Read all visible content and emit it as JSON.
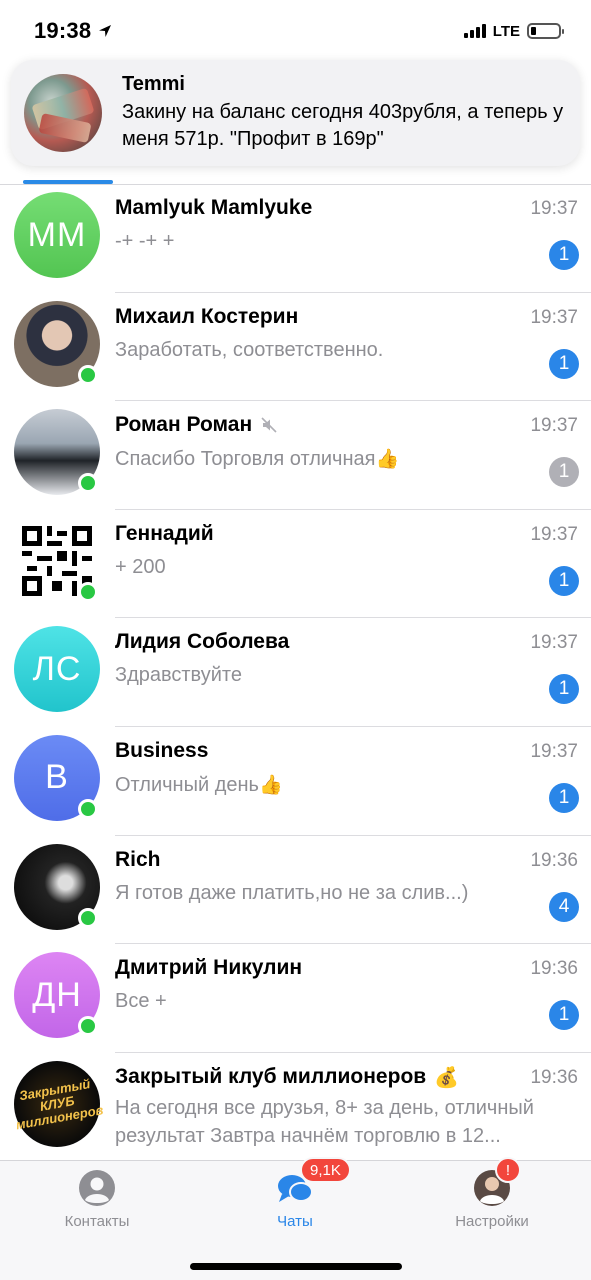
{
  "status_bar": {
    "time": "19:38",
    "network": "LTE"
  },
  "notification": {
    "title": "Temmi",
    "body": "Закину на баланс сегодня 403рубля, а теперь у меня 571р. \"Профит в 169р\""
  },
  "chats": [
    {
      "name": "Mamlyuk Mamlyuke",
      "preview": "-+ -+ +",
      "time": "19:37",
      "unread": "1",
      "avatar_initials": "MM",
      "avatar_color": "#5ccb5b",
      "online": false,
      "muted": false
    },
    {
      "name": "Михаил Костерин",
      "preview": "Заработать, соответственно.",
      "time": "19:37",
      "unread": "1",
      "avatar_initials": "",
      "online": true,
      "muted": false
    },
    {
      "name": "Роман Роман",
      "preview": "Спасибо Торговля отличная",
      "time": "19:37",
      "unread": "1",
      "avatar_initials": "",
      "online": true,
      "muted": true
    },
    {
      "name": "Геннадий",
      "preview": "+ 200",
      "time": "19:37",
      "unread": "1",
      "avatar_initials": "",
      "online": true,
      "muted": false
    },
    {
      "name": "Лидия Соболева",
      "preview": "Здравствуйте",
      "time": "19:37",
      "unread": "1",
      "avatar_initials": "ЛС",
      "avatar_color": "#2bcfd4",
      "online": false,
      "muted": false
    },
    {
      "name": "Business",
      "preview": "Отличный день",
      "time": "19:37",
      "unread": "1",
      "avatar_initials": "B",
      "avatar_color": "#5b7bee",
      "online": true,
      "muted": false
    },
    {
      "name": "Rich",
      "preview": "Я готов даже платить,но не за слив...)",
      "time": "19:36",
      "unread": "4",
      "avatar_initials": "",
      "online": true,
      "muted": false
    },
    {
      "name": "Дмитрий Никулин",
      "preview": "Все +",
      "time": "19:36",
      "unread": "1",
      "avatar_initials": "ДН",
      "avatar_color": "#cf72ed",
      "online": true,
      "muted": false
    },
    {
      "name": "Закрытый клуб миллионеров",
      "preview": "На сегодня все друзья, 8+ за день, отличный результат   Завтра начнём торговлю в 12...",
      "time": "19:36",
      "unread": "",
      "avatar_initials": "",
      "online": false,
      "muted": false
    }
  ],
  "club_avatar_text": "Закрытый КЛУБ миллионеров",
  "tab_bar": {
    "contacts": "Контакты",
    "chats": "Чаты",
    "chats_badge": "9,1K",
    "settings": "Настройки",
    "settings_badge": "!"
  },
  "colors": {
    "accent": "#2a86e8",
    "online": "#29c843",
    "badge_muted": "#b0b0b6",
    "tab_badge": "#f2463c"
  },
  "icons": {
    "location": "location-arrow-icon",
    "mute": "speaker-muted-icon",
    "thumbs_up": "thumbs-up-emoji",
    "money_bag": "money-bag-emoji",
    "fire": "fire-emoji"
  }
}
